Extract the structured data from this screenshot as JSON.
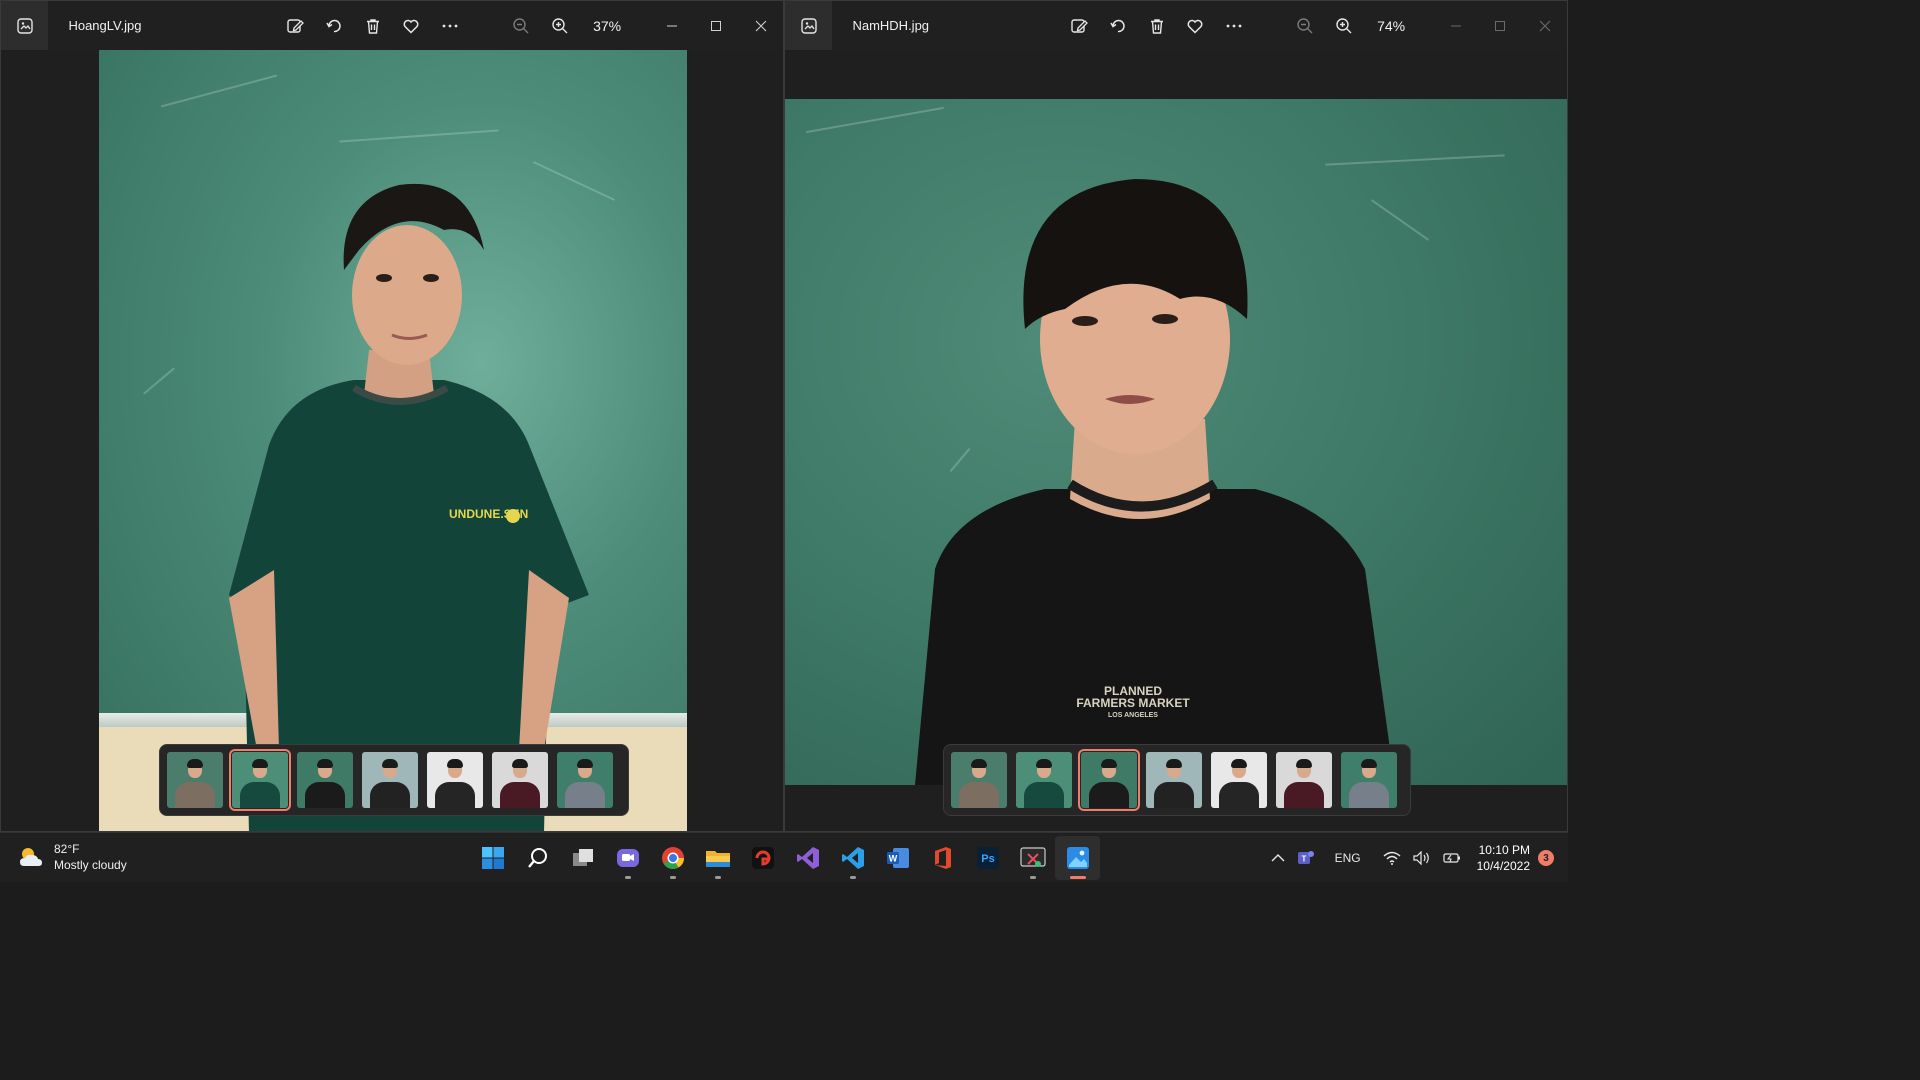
{
  "windows": [
    {
      "filename": "HoangLV.jpg",
      "zoom": "37%",
      "shirt_text": "UNDUNE.SEN",
      "thumbnails": [
        {
          "bg": "#4b7d6c",
          "shirt": "#7c6e61"
        },
        {
          "bg": "#4d8e79",
          "shirt": "#174a3e",
          "selected": true
        },
        {
          "bg": "#3f7a67",
          "shirt": "#1b1b1b"
        },
        {
          "bg": "#9fb7b9",
          "shirt": "#222222"
        },
        {
          "bg": "#e8e8e8",
          "shirt": "#252525"
        },
        {
          "bg": "#d9d9d9",
          "shirt": "#4a1a24"
        },
        {
          "bg": "#3f7e6b",
          "shirt": "#77808a"
        }
      ]
    },
    {
      "filename": "NamHDH.jpg",
      "zoom": "74%",
      "shirt_text_1": "PLANNED",
      "shirt_text_2": "FARMERS MARKET",
      "shirt_text_3": "LOS ANGELES",
      "thumbnails": [
        {
          "bg": "#4b7d6c",
          "shirt": "#7c6e61"
        },
        {
          "bg": "#4d8e79",
          "shirt": "#174a3e"
        },
        {
          "bg": "#3f7a67",
          "shirt": "#1b1b1b",
          "selected": true
        },
        {
          "bg": "#9fb7b9",
          "shirt": "#222222"
        },
        {
          "bg": "#e8e8e8",
          "shirt": "#252525"
        },
        {
          "bg": "#d9d9d9",
          "shirt": "#4a1a24"
        },
        {
          "bg": "#3f7e6b",
          "shirt": "#77808a"
        }
      ]
    }
  ],
  "taskbar": {
    "weather_temp": "82°F",
    "weather_desc": "Mostly cloudy",
    "language": "ENG",
    "time": "10:10 PM",
    "date": "10/4/2022",
    "notification_count": "3",
    "apps": [
      "start-icon",
      "search-icon",
      "task-view-icon",
      "teams-chat-icon",
      "chrome-icon",
      "file-explorer-icon",
      "garena-icon",
      "visual-studio-icon",
      "vscode-icon",
      "word-icon",
      "office-icon",
      "photoshop-icon",
      "snipping-tool-icon",
      "photos-icon"
    ]
  },
  "colors": {
    "accent": "#f07c6a",
    "titlebar": "#202020",
    "taskbar": "#202020"
  }
}
